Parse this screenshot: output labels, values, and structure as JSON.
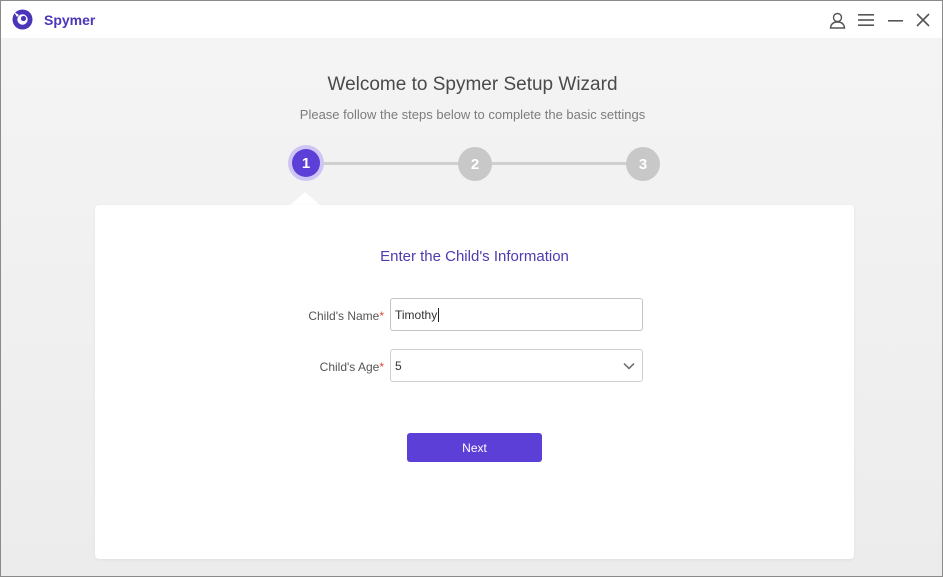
{
  "titlebar": {
    "app_name": "Spymer",
    "logo_icon": "spymer-logo-icon",
    "controls": [
      "user-icon",
      "menu-icon",
      "minimize-icon",
      "close-icon"
    ]
  },
  "wizard": {
    "title": "Welcome to Spymer Setup Wizard",
    "subtitle": "Please follow the steps below to complete the basic settings",
    "steps": [
      {
        "number": "1",
        "state": "active"
      },
      {
        "number": "2",
        "state": "inactive"
      },
      {
        "number": "3",
        "state": "inactive"
      }
    ]
  },
  "form": {
    "title": "Enter the Child's Information",
    "name_label": "Child's Name",
    "name_value": "Timothy",
    "age_label": "Child's Age",
    "age_value": "5",
    "required_mark": "*",
    "next_label": "Next"
  },
  "colors": {
    "accent": "#5b3fd6",
    "title_text": "#4d3bb0",
    "required": "#e2483d",
    "inactive_step": "#c8c8c8"
  }
}
